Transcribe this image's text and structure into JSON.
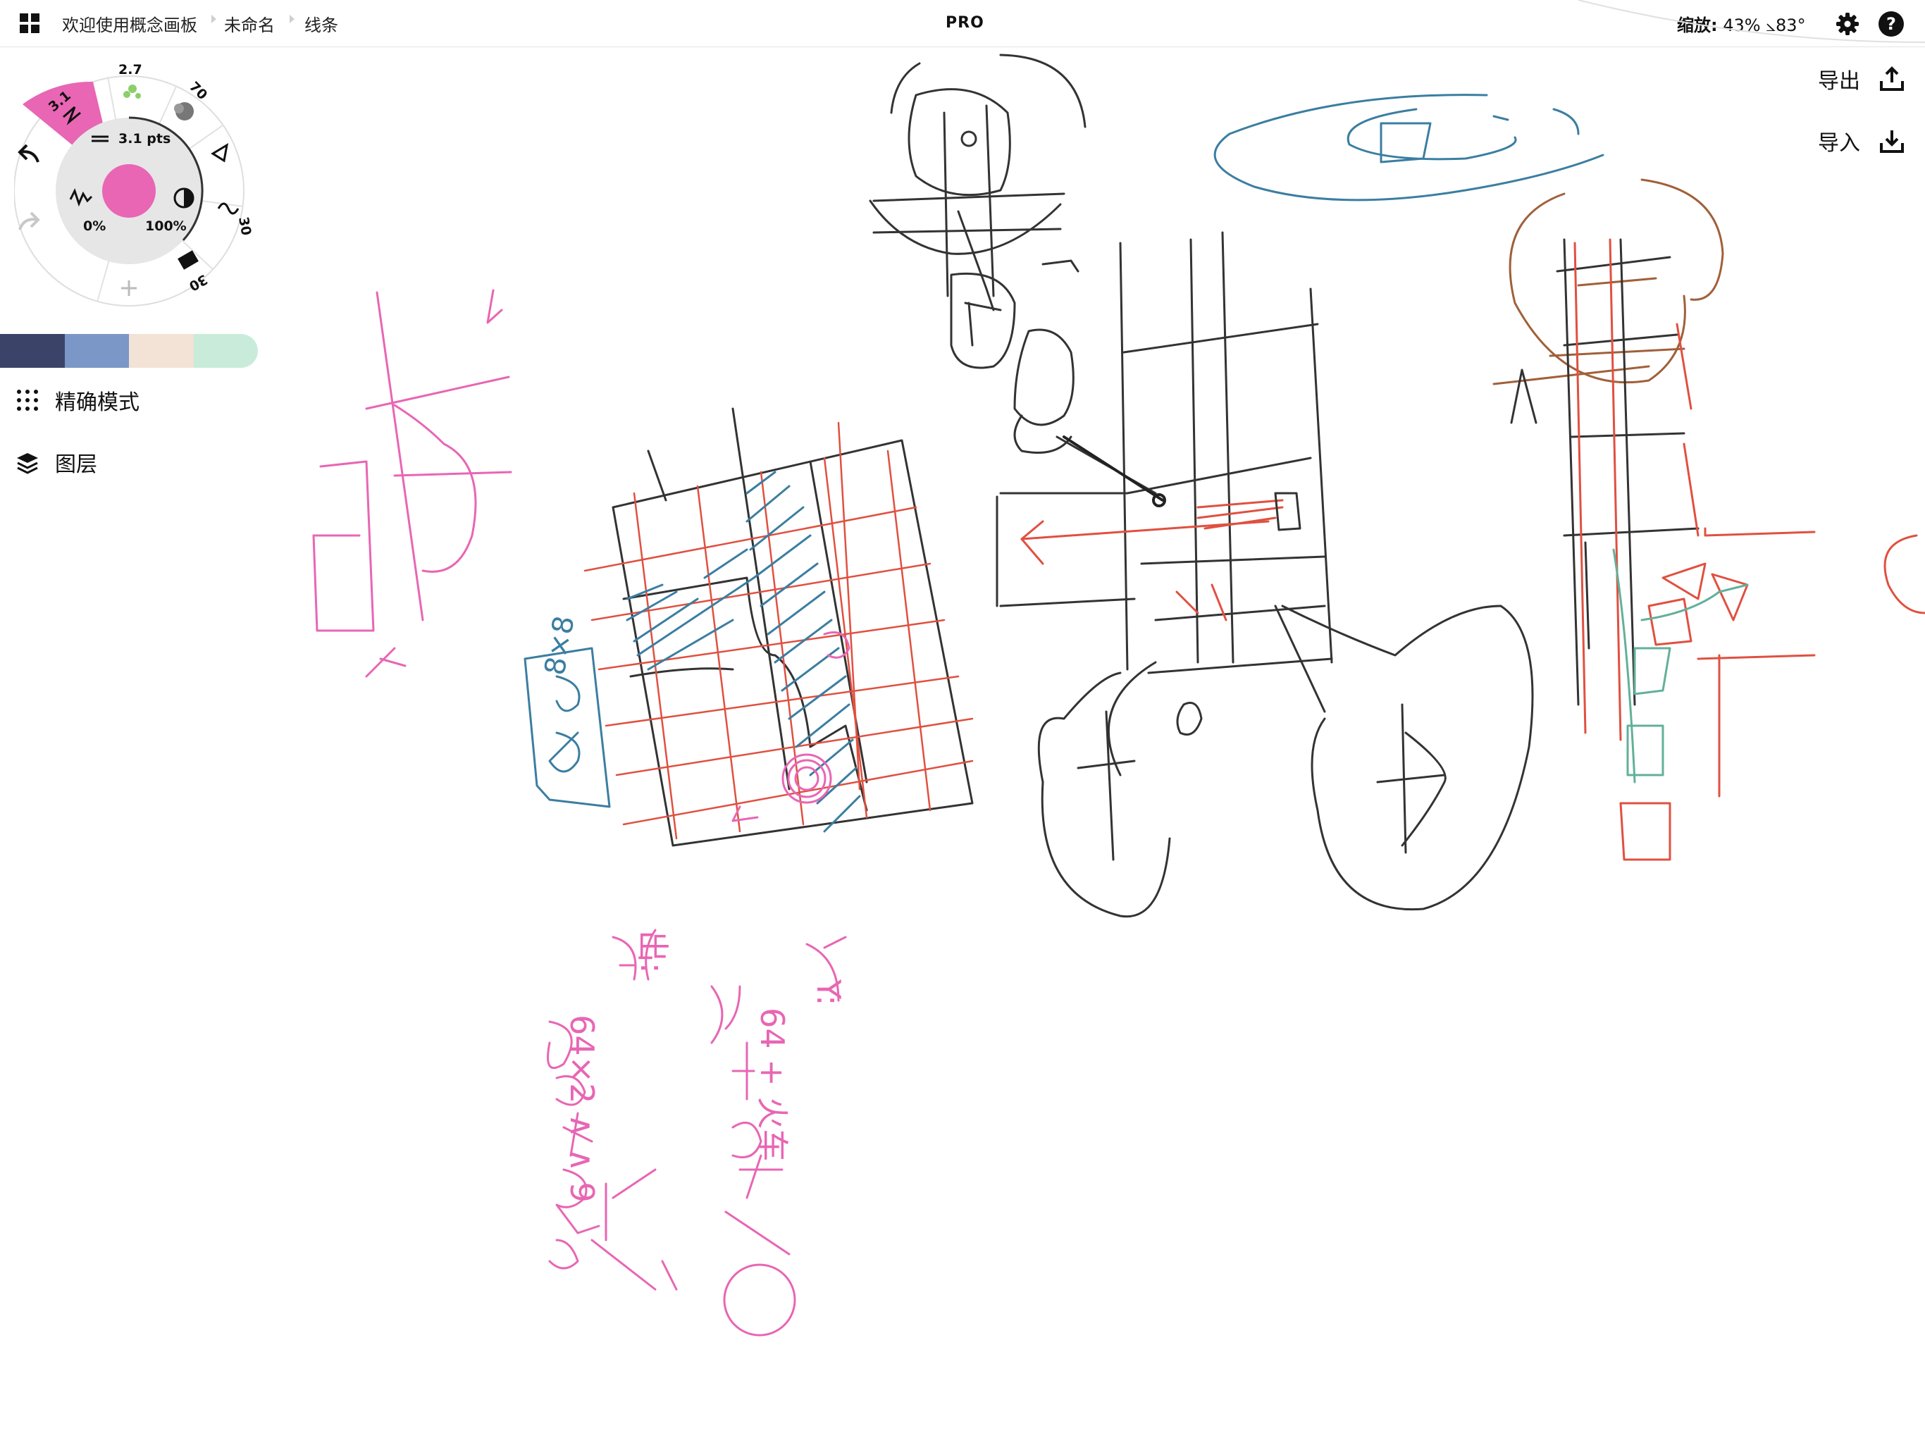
{
  "topbar": {
    "breadcrumbs": [
      "欢迎使用概念画板",
      "未命名",
      "线条"
    ],
    "pro_badge": "PRO",
    "zoom_label": "缩放:",
    "zoom_value": "43%",
    "rotation_value": "⦣83°"
  },
  "actions": {
    "export_label": "导出",
    "import_label": "导入"
  },
  "tool_wheel": {
    "active_brush_size": "3.1",
    "brush_2_size": "2.7",
    "brush_3_size": "70",
    "brush_4_size": "30",
    "brush_5_size": "30",
    "stroke_size_label": "3.1 pts",
    "smoothing_value": "0%",
    "opacity_value": "100%",
    "current_color": "#e866b4"
  },
  "swatches": [
    "#3b4468",
    "#7b97c7",
    "#f3e2d6",
    "#c8ecd9"
  ],
  "menu": {
    "precision_mode": "精确模式",
    "layers": "图层"
  },
  "canvas_text": {
    "pink_note_1": "Y:",
    "pink_note_2": "64 + 火车",
    "pink_note_3": "出:",
    "pink_note_4": "64×2 ∧ ∧ 9",
    "blue_box_text": "8×8"
  }
}
